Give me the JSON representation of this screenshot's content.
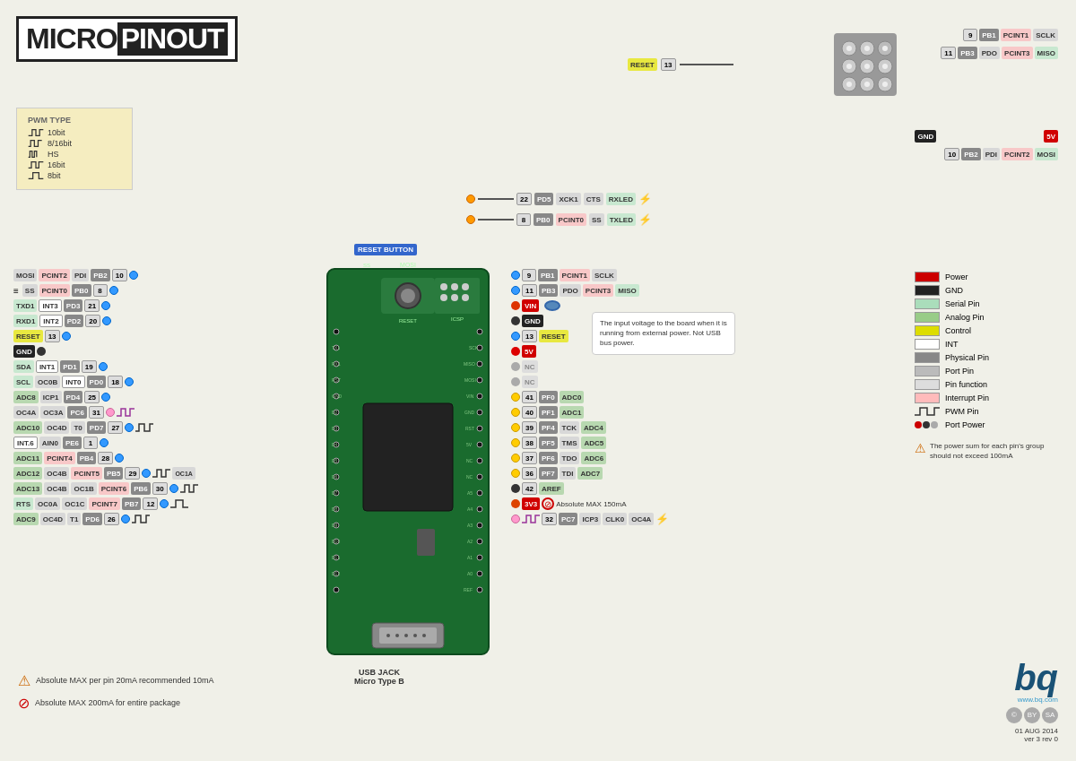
{
  "title": {
    "micro": "MICRO",
    "pinout": "PINOUT"
  },
  "pwm_legend": {
    "title": "PWM TYPE",
    "items": [
      {
        "label": "10bit",
        "type": "wave1"
      },
      {
        "label": "8/16bit",
        "type": "wave2"
      },
      {
        "label": "HS",
        "type": "wave3"
      },
      {
        "label": "16bit",
        "type": "wave4"
      },
      {
        "label": "8bit",
        "type": "wave5"
      }
    ]
  },
  "legend": {
    "items": [
      {
        "label": "Power",
        "color": "#cc0000"
      },
      {
        "label": "GND",
        "color": "#222222"
      },
      {
        "label": "Serial Pin",
        "color": "#aaddbb"
      },
      {
        "label": "Analog Pin",
        "color": "#99cc88"
      },
      {
        "label": "Control",
        "color": "#dddd00"
      },
      {
        "label": "INT",
        "color": "#ffffff"
      },
      {
        "label": "Physical Pin",
        "color": "#888888"
      },
      {
        "label": "Port Pin",
        "color": "#bbbbbb"
      },
      {
        "label": "Pin function",
        "color": "#dddddd"
      },
      {
        "label": "Interrupt Pin",
        "color": "#ffbbbb"
      },
      {
        "label": "PWM Pin",
        "color": "#ffffff"
      },
      {
        "label": "Port Power",
        "color": "#ffffff"
      }
    ]
  },
  "top_section": {
    "reset_label": "RESET",
    "reset_num": "13",
    "rows": [
      {
        "num": "9",
        "labels": [
          "PB1",
          "PCINT1",
          "SCLK"
        ]
      },
      {
        "num": "11",
        "labels": [
          "PB3",
          "PDO",
          "PCINT3",
          "MISO"
        ]
      },
      {
        "gnd": "GND",
        "power5v": "5V"
      },
      {
        "num": "10",
        "labels": [
          "PB2",
          "PDI",
          "PCINT2",
          "MOSI"
        ]
      }
    ]
  },
  "top_connectors": {
    "row1": {
      "num": "22",
      "labels": [
        "PD5",
        "XCK1",
        "CTS",
        "RXLED"
      ]
    },
    "row2": {
      "num": "8",
      "labels": [
        "PB0",
        "PCINT0",
        "SS",
        "TXLED"
      ]
    }
  },
  "left_pins": [
    {
      "num": "10",
      "labels": [
        "MOSI",
        "PCINT2",
        "PDI",
        "PB2"
      ]
    },
    {
      "num": "8",
      "labels": [
        "SS",
        "PCINT0",
        "PB0"
      ],
      "icon": "stream"
    },
    {
      "num": "21",
      "labels": [
        "TXD1",
        "INT3",
        "PD3"
      ]
    },
    {
      "num": "20",
      "labels": [
        "RXD1",
        "INT2",
        "PD2"
      ]
    },
    {
      "num": "13",
      "labels": [
        "RESET"
      ],
      "special": "reset"
    },
    {
      "num": null,
      "labels": [
        "GND"
      ],
      "special": "gnd"
    },
    {
      "num": "19",
      "labels": [
        "SDA",
        "INT1",
        "PD1"
      ]
    },
    {
      "num": "18",
      "labels": [
        "SCL",
        "OC0B",
        "INT0",
        "PD0"
      ]
    },
    {
      "num": "25",
      "labels": [
        "ADC8",
        "ICP1",
        "PD4"
      ]
    },
    {
      "num": "31",
      "labels": [
        "OC4A",
        "OC3A",
        "PC6"
      ]
    },
    {
      "num": "27",
      "labels": [
        "ADC10",
        "OC4D",
        "T0",
        "PD7"
      ]
    },
    {
      "num": "1",
      "labels": [
        "INT.6",
        "AIN0",
        "PE6"
      ]
    },
    {
      "num": "28",
      "labels": [
        "ADC11",
        "PCINT4",
        "PB4"
      ]
    },
    {
      "num": "29",
      "labels": [
        "ADC12",
        "OC4B",
        "PCINT5",
        "PB5",
        "OC1A"
      ]
    },
    {
      "num": "30",
      "labels": [
        "ADC13",
        "OC4B",
        "OC1B",
        "PCINT6",
        "PB6"
      ]
    },
    {
      "num": "12",
      "labels": [
        "RTS",
        "OC0A",
        "OC1C",
        "PCINT7",
        "PB7"
      ]
    },
    {
      "num": "26",
      "labels": [
        "ADC9",
        "OC4D",
        "T1",
        "PD6"
      ]
    }
  ],
  "right_pins": [
    {
      "num": "9",
      "labels": [
        "PB1",
        "PCINT1",
        "SCLK"
      ]
    },
    {
      "num": "11",
      "labels": [
        "PB3",
        "PDO",
        "PCINT3",
        "MISO"
      ]
    },
    {
      "special": "VIN",
      "label": "VIN"
    },
    {
      "special": "GND",
      "label": "GND"
    },
    {
      "num": "13",
      "special": "RESET",
      "label": "RESET"
    },
    {
      "special": "5V",
      "label": "5V"
    },
    {
      "special": "NC",
      "label": "NC"
    },
    {
      "special": "NC",
      "label": "NC"
    },
    {
      "num": "41",
      "labels": [
        "PF0",
        "ADC0"
      ]
    },
    {
      "num": "40",
      "labels": [
        "PF1",
        "ADC1"
      ]
    },
    {
      "num": "39",
      "labels": [
        "PF4",
        "TCK",
        "ADC4"
      ]
    },
    {
      "num": "38",
      "labels": [
        "PF5",
        "TMS",
        "ADC5"
      ]
    },
    {
      "num": "37",
      "labels": [
        "PF6",
        "TDO",
        "ADC6"
      ]
    },
    {
      "num": "36",
      "labels": [
        "PF7",
        "TDI",
        "ADC7"
      ]
    },
    {
      "num": "42",
      "special": "AREF",
      "label": "AREF"
    },
    {
      "special": "3V3",
      "label": "3V3"
    },
    {
      "num": "32",
      "labels": [
        "PC7",
        "ICP3",
        "CLK0",
        "OC4A"
      ]
    }
  ],
  "board": {
    "reset_button_label": "RESET BUTTON",
    "usb_label": "USB JACK\nMicro Type B"
  },
  "tooltip": {
    "text": "The input voltage to the board when it is running from external power. Not USB bus power."
  },
  "warnings": {
    "w1": "Absolute MAX per pin 20mA\nrecommended 10mA",
    "w2": "Absolute MAX 200mA\nfor entire package"
  },
  "power_warning": "The power sum for each pin's\ngroup should not exceed 100mA",
  "copyright": {
    "website": "www.bq.com",
    "date": "01 AUG 2014",
    "version": "ver 3 rev 0",
    "logo": "bq"
  }
}
